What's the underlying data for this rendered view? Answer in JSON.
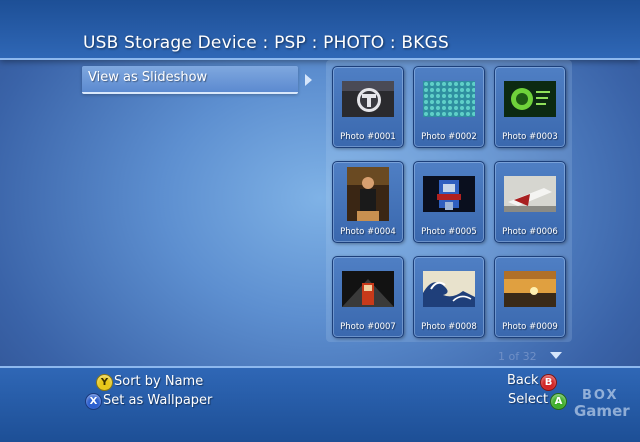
{
  "header": {
    "breadcrumb": "USB Storage Device : PSP : PHOTO : BKGS"
  },
  "menu": {
    "items": [
      {
        "label": "View as Slideshow",
        "selected": true
      }
    ]
  },
  "photos": [
    {
      "label": "Photo #0001"
    },
    {
      "label": "Photo #0002"
    },
    {
      "label": "Photo #0003"
    },
    {
      "label": "Photo #0004"
    },
    {
      "label": "Photo #0005"
    },
    {
      "label": "Photo #0006"
    },
    {
      "label": "Photo #0007"
    },
    {
      "label": "Photo #0008"
    },
    {
      "label": "Photo #0009"
    }
  ],
  "pager": {
    "text": "1 of 32"
  },
  "controls": {
    "sort": {
      "button": "Y",
      "label": "Sort by Name"
    },
    "wallpaper": {
      "button": "X",
      "label": "Set as Wallpaper"
    },
    "back": {
      "button": "B",
      "label": "Back"
    },
    "select": {
      "button": "A",
      "label": "Select"
    }
  },
  "watermark": {
    "line1": "BOX",
    "line2": "Gamer"
  },
  "colors": {
    "background": "#5d8fd0",
    "strip": "#2f67b6",
    "button_y": "#e8c81a",
    "button_x": "#2c5fcf",
    "button_b": "#d22626",
    "button_a": "#3fae2b"
  }
}
